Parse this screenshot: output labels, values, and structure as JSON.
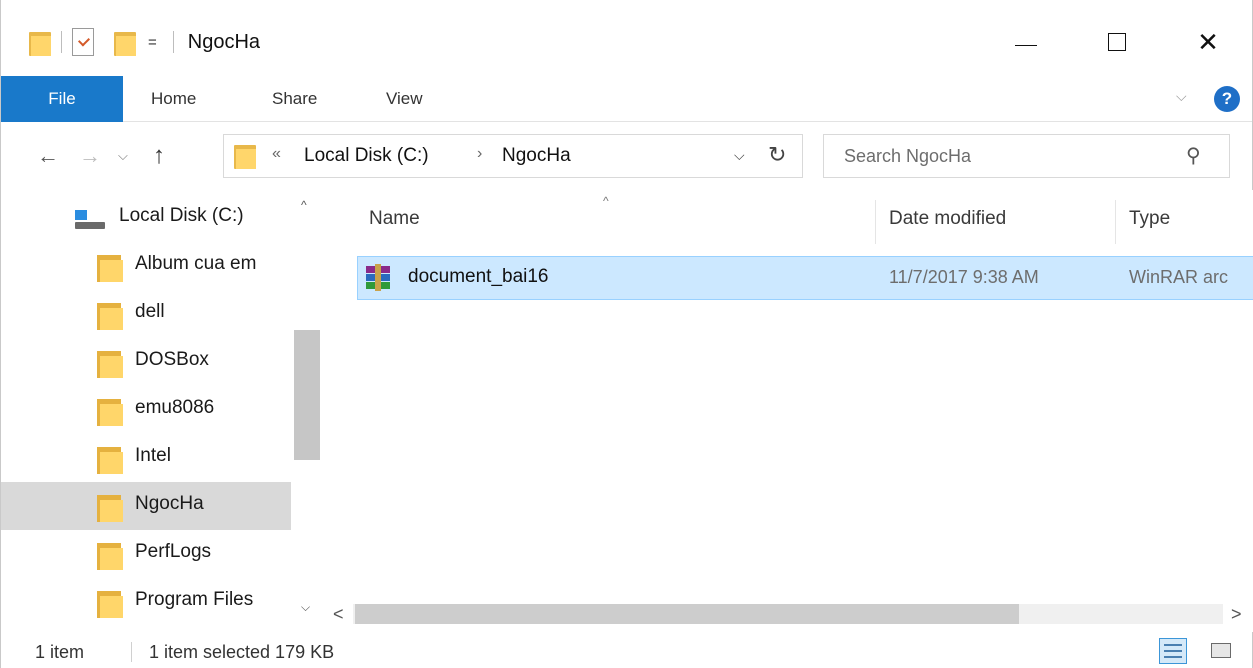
{
  "window": {
    "title": "NgocHa",
    "qat_dropdown": "=",
    "minimize_label": "",
    "close_symbol": "✕"
  },
  "ribbon": {
    "tabs": [
      {
        "label": "File"
      },
      {
        "label": "Home"
      },
      {
        "label": "Share"
      },
      {
        "label": "View"
      }
    ],
    "collapse_symbol": "⌵",
    "help_symbol": "?"
  },
  "navigation": {
    "back_symbol": "←",
    "forward_symbol": "→",
    "recent_symbol": "⌵",
    "up_symbol": "↑"
  },
  "address": {
    "overflow_symbol": "«",
    "breadcrumbs": [
      "Local Disk (C:)",
      "NgocHa"
    ],
    "separator": "›",
    "dropdown_symbol": "⌵",
    "refresh_symbol": "↻"
  },
  "search": {
    "placeholder": "Search NgocHa",
    "icon_symbol": "⚲"
  },
  "nav_pane": {
    "root": "Local Disk (C:)",
    "items": [
      {
        "label": "Album cua em"
      },
      {
        "label": "dell"
      },
      {
        "label": "DOSBox"
      },
      {
        "label": "emu8086"
      },
      {
        "label": "Intel"
      },
      {
        "label": "NgocHa"
      },
      {
        "label": "PerfLogs"
      },
      {
        "label": "Program Files"
      }
    ],
    "selected": "NgocHa",
    "scroll_up": "^",
    "scroll_down": "⌵"
  },
  "file_list": {
    "sort_indicator": "^",
    "columns": [
      "Name",
      "Date modified",
      "Type"
    ],
    "rows": [
      {
        "name": "document_bai16",
        "date_modified": "11/7/2017 9:38 AM",
        "type": "WinRAR arc"
      }
    ],
    "scroll_left": "<",
    "scroll_right": ">"
  },
  "status": {
    "item_count": "1 item",
    "selection": "1 item selected  179 KB"
  },
  "colors": {
    "file_tab": "#1979ca",
    "selection_bg": "#cce8ff",
    "selection_border": "#99d1ff",
    "nav_selected": "#d9d9d9",
    "help": "#1f6fc7"
  }
}
